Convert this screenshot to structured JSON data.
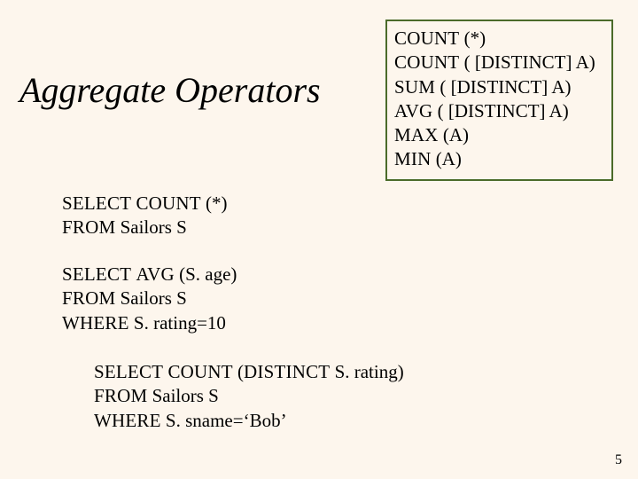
{
  "title": "Aggregate Operators",
  "agg": {
    "count_star": {
      "fn": "COUNT",
      "rest": " (*)"
    },
    "count_dist": {
      "fn": "COUNT",
      "rest": " ( [DISTINCT] A)"
    },
    "sum_dist": {
      "fn": "SUM",
      "rest": " ( [DISTINCT] A)"
    },
    "avg_dist": {
      "fn": "AVG",
      "rest": " ( [DISTINCT] A)"
    },
    "max_a": {
      "fn": "MAX",
      "rest": " (A)"
    },
    "min_a": {
      "fn": "MIN",
      "rest": " (A)"
    }
  },
  "kw": {
    "select": "SELECT",
    "from": "FROM",
    "where": "WHERE",
    "count": "COUNT",
    "avg": "AVG",
    "distinct": "DISTINCT"
  },
  "q1": {
    "select_count_args": " (*)",
    "from_body": "  Sailors S"
  },
  "q2": {
    "avg_args": " (S. age)",
    "from_body": "  Sailors S",
    "where_body": "  S. rating=10"
  },
  "q3": {
    "count_open": " (",
    "count_rest": " S. rating)",
    "from_body": "  Sailors S",
    "where_body": " S. sname=‘Bob’"
  },
  "page": "5"
}
